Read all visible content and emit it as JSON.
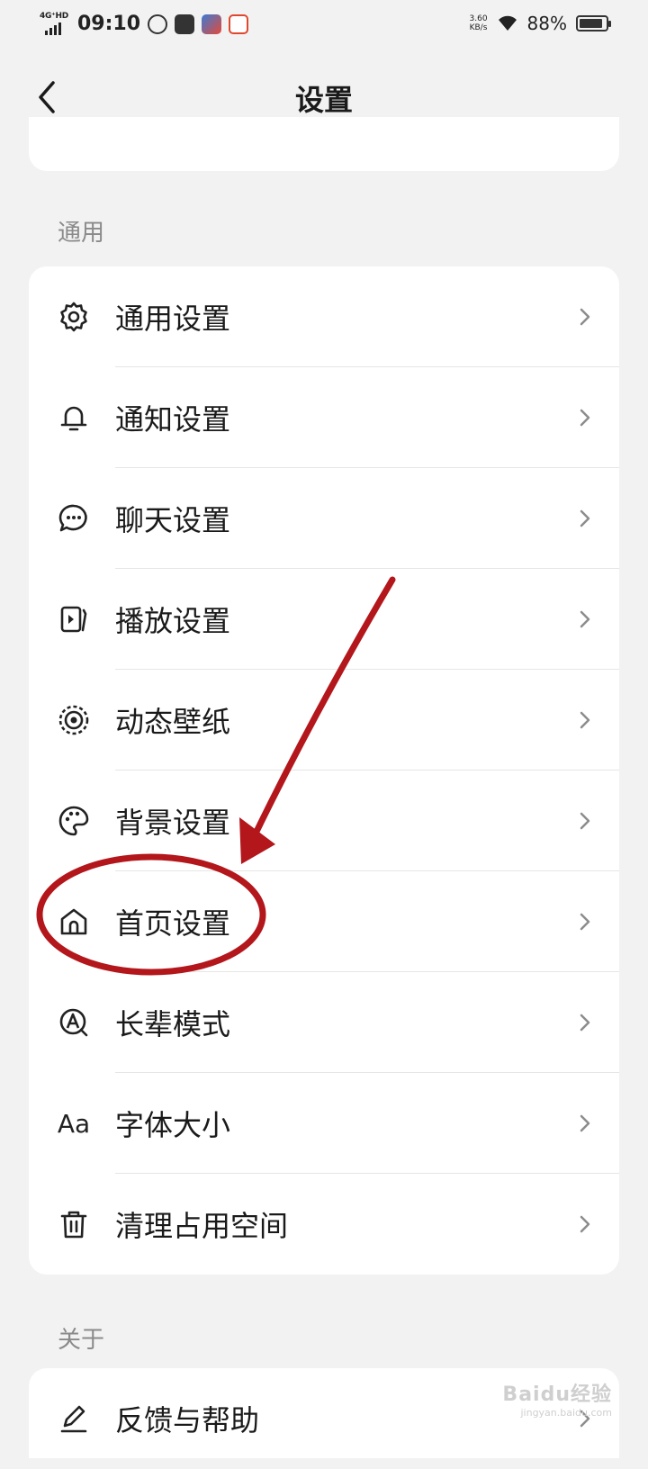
{
  "status_bar": {
    "network": "4G⁺HD",
    "time": "09:10",
    "speed_value": "3.60",
    "speed_unit": "KB/s",
    "battery": "88%",
    "battery_level": 0.88
  },
  "nav": {
    "title": "设置"
  },
  "sections": {
    "general": "通用",
    "about": "关于"
  },
  "general_items": [
    {
      "label": "通用设置",
      "icon": "gear-icon"
    },
    {
      "label": "通知设置",
      "icon": "bell-icon"
    },
    {
      "label": "聊天设置",
      "icon": "chat-bubble-icon"
    },
    {
      "label": "播放设置",
      "icon": "play-screen-icon"
    },
    {
      "label": "动态壁纸",
      "icon": "live-wallpaper-icon"
    },
    {
      "label": "背景设置",
      "icon": "palette-icon"
    },
    {
      "label": "首页设置",
      "icon": "home-icon"
    },
    {
      "label": "长辈模式",
      "icon": "elder-mode-icon"
    },
    {
      "label": "字体大小",
      "icon": "font-size-icon",
      "icon_text": "Aa"
    },
    {
      "label": "清理占用空间",
      "icon": "trash-icon"
    }
  ],
  "about_items": [
    {
      "label": "反馈与帮助",
      "icon": "edit-pen-icon"
    }
  ],
  "watermark": {
    "text": "Baidu经验",
    "sub": "jingyan.baidu.com"
  },
  "colors": {
    "background": "#f2f2f2",
    "card": "#ffffff",
    "annotation_red": "#b3161b"
  }
}
